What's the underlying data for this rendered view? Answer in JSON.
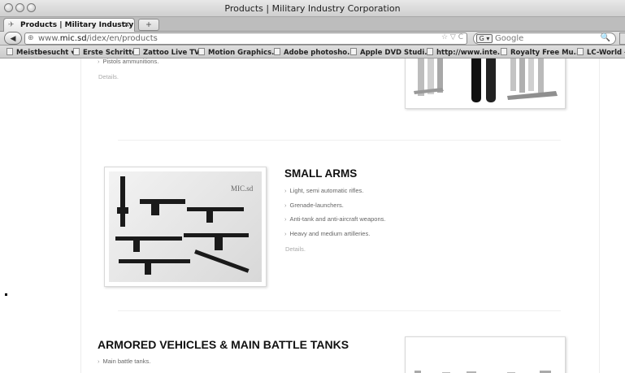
{
  "window": {
    "title": "Products | Military Industry Corporation"
  },
  "tabs": [
    {
      "label": "Products | Military Industry Cor...",
      "close_glyph": "×"
    }
  ],
  "new_tab_glyph": "+",
  "navbar": {
    "url_prefix": "www.",
    "url_host": "mic.sd",
    "url_path": "/idex/en/products",
    "url_tools": "☆ ▽ C",
    "search_engine": "G ▾",
    "search_placeholder": "Google",
    "search_glyph": "🔍"
  },
  "bookmarks": [
    {
      "label": "Meistbesucht ▾"
    },
    {
      "label": "Erste Schritte"
    },
    {
      "label": "Zattoo Live TV!"
    },
    {
      "label": "Motion Graphics..."
    },
    {
      "label": "Adobe photosho..."
    },
    {
      "label": "Apple DVD Studi..."
    },
    {
      "label": "http://www.inte..."
    },
    {
      "label": "Royalty Free Mu..."
    },
    {
      "label": "LC-World –"
    }
  ],
  "sections": {
    "pistols": {
      "bullets": [
        "Pistols ammunitions."
      ],
      "details": "Details."
    },
    "small_arms": {
      "title": "SMALL ARMS",
      "bullets": [
        "Light, semi automatic rifles.",
        "Grenade-launchers.",
        "Anti-tank and anti-aircraft weapons.",
        "Heavy and medium artilleries."
      ],
      "details": "Details.",
      "watermark": "MIC.sd"
    },
    "armored": {
      "title": "ARMORED VEHICLES & MAIN BATTLE TANKS",
      "bullets": [
        "Main battle tanks."
      ]
    }
  },
  "icons": {
    "back": "◀",
    "globe": "⊕",
    "favicon": "✈"
  }
}
